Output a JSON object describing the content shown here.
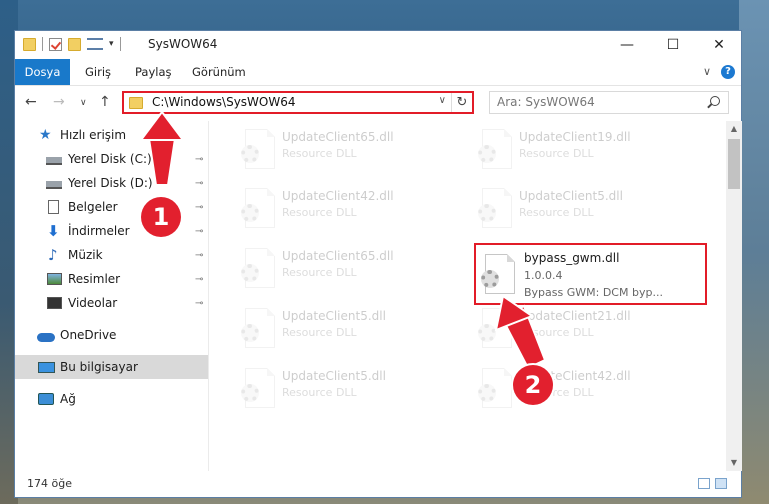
{
  "window": {
    "title": "SysWOW64",
    "minimize": "—",
    "maximize": "☐",
    "close": "✕"
  },
  "ribbon": {
    "tabs": [
      "Dosya",
      "Giriş",
      "Paylaş",
      "Görünüm"
    ],
    "expand": "∨",
    "help": "?"
  },
  "nav": {
    "back": "←",
    "forward": "→",
    "recent": "∨",
    "up": "↑",
    "address": "C:\\Windows\\SysWOW64",
    "address_dropdown": "∨",
    "refresh": "↻",
    "search_placeholder": "Ara: SysWOW64"
  },
  "sidebar": {
    "items": [
      {
        "label": "Hızlı erişim",
        "icon": "star-icon"
      },
      {
        "label": "Yerel Disk (C:)",
        "icon": "drive-icon",
        "pinned": true
      },
      {
        "label": "Yerel Disk (D:)",
        "icon": "drive-icon",
        "pinned": true
      },
      {
        "label": "Belgeler",
        "icon": "document-icon",
        "pinned": true
      },
      {
        "label": "İndirmeler",
        "icon": "download-icon",
        "pinned": true
      },
      {
        "label": "Müzik",
        "icon": "music-icon",
        "pinned": true
      },
      {
        "label": "Resimler",
        "icon": "pictures-icon",
        "pinned": true
      },
      {
        "label": "Videolar",
        "icon": "videos-icon",
        "pinned": true
      },
      {
        "label": "OneDrive",
        "icon": "cloud-icon"
      },
      {
        "label": "Bu bilgisayar",
        "icon": "computer-icon",
        "selected": true
      },
      {
        "label": "Ağ",
        "icon": "network-icon"
      }
    ],
    "pin_glyph": "📌"
  },
  "files": [
    {
      "name": "UpdateClient65.dll",
      "desc": "Resource DLL",
      "faded": true
    },
    {
      "name": "UpdateClient19.dll",
      "desc": "Resource DLL",
      "faded": true
    },
    {
      "name": "UpdateClient42.dll",
      "desc": "Resource DLL",
      "faded": true
    },
    {
      "name": "UpdateClient5.dll",
      "desc": "Resource DLL",
      "faded": true
    },
    {
      "name": "UpdateClient65.dll",
      "desc": "Resource DLL",
      "faded": true
    },
    {
      "name": "UpdateClient5.dll",
      "desc": "Resource DLL",
      "faded": true
    },
    {
      "name": "UpdateClient21.dll",
      "desc": "Resource DLL",
      "faded": true
    },
    {
      "name": "UpdateClient5.dll",
      "desc": "Resource DLL",
      "faded": true
    },
    {
      "name": "UpdateClient42.dll",
      "desc": "Resource DLL",
      "faded": true
    }
  ],
  "highlighted_file": {
    "name": "bypass_gwm.dll",
    "version": "1.0.0.4",
    "desc": "Bypass GWM: DCM byp..."
  },
  "status": {
    "item_count": "174 öğe"
  },
  "annotations": {
    "step1": "1",
    "step2": "2",
    "color": "#e2202e"
  }
}
